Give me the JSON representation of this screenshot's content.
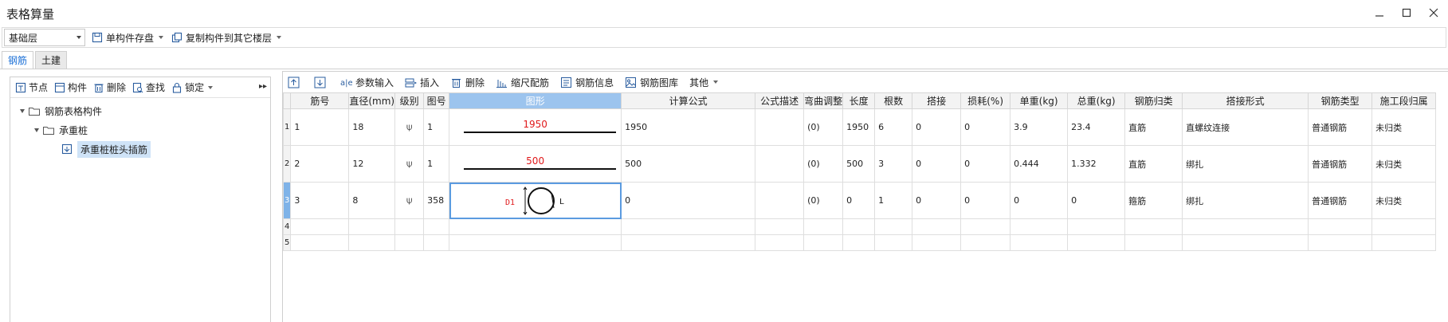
{
  "window": {
    "title": "表格算量",
    "controls": [
      "minimize",
      "maximize",
      "close"
    ]
  },
  "toolbar1": {
    "layer_value": "基础层",
    "save_component_label": "单构件存盘",
    "copy_component_label": "复制构件到其它楼层"
  },
  "tabs": [
    {
      "label": "钢筋",
      "active": true
    },
    {
      "label": "土建",
      "active": false
    }
  ],
  "left_toolbar": {
    "node_label": "节点",
    "component_label": "构件",
    "delete_label": "删除",
    "find_label": "查找",
    "lock_label": "锁定"
  },
  "tree": {
    "root": "钢筋表格构件",
    "child": "承重桩",
    "leaf": "承重桩桩头插筋"
  },
  "right_toolbar": {
    "param_input": "参数输入",
    "insert": "插入",
    "delete": "删除",
    "scale_rebar": "缩尺配筋",
    "rebar_info": "钢筋信息",
    "rebar_library": "钢筋图库",
    "other": "其他"
  },
  "table": {
    "headers": [
      "筋号",
      "直径(mm)",
      "级别",
      "图号",
      "图形",
      "计算公式",
      "公式描述",
      "弯曲调整",
      "长度",
      "根数",
      "搭接",
      "损耗(%)",
      "单重(kg)",
      "总重(kg)",
      "钢筋归类",
      "搭接形式",
      "钢筋类型",
      "施工段归属"
    ],
    "rows": [
      {
        "num": "1",
        "bar": "1",
        "dia": "18",
        "level": "⍦",
        "fig": "1",
        "shape_len": "1950",
        "formula": "1950",
        "desc": "",
        "bend": "(0)",
        "length": "1950",
        "count": "6",
        "lap": "0",
        "loss": "0",
        "unit_w": "3.9",
        "total_w": "23.4",
        "category": "直筋",
        "lap_type": "直螺纹连接",
        "rebar_type": "普通钢筋",
        "section": "未归类"
      },
      {
        "num": "2",
        "bar": "2",
        "dia": "12",
        "level": "⍦",
        "fig": "1",
        "shape_len": "500",
        "formula": "500",
        "desc": "",
        "bend": "(0)",
        "length": "500",
        "count": "3",
        "lap": "0",
        "loss": "0",
        "unit_w": "0.444",
        "total_w": "1.332",
        "category": "直筋",
        "lap_type": "绑扎",
        "rebar_type": "普通钢筋",
        "section": "未归类"
      },
      {
        "num": "3",
        "bar": "3",
        "dia": "8",
        "level": "⍦",
        "fig": "358",
        "shape_d": "D1",
        "shape_l": "L",
        "formula": "0",
        "desc": "",
        "bend": "(0)",
        "length": "0",
        "count": "1",
        "lap": "0",
        "loss": "0",
        "unit_w": "0",
        "total_w": "0",
        "category": "箍筋",
        "lap_type": "绑扎",
        "rebar_type": "普通钢筋",
        "section": "未归类"
      },
      {
        "num": "4"
      },
      {
        "num": "5"
      }
    ]
  },
  "colors": {
    "accent": "#1a6fd6",
    "selected_header": "#9cc4ee",
    "shape_text": "#e0191b"
  }
}
